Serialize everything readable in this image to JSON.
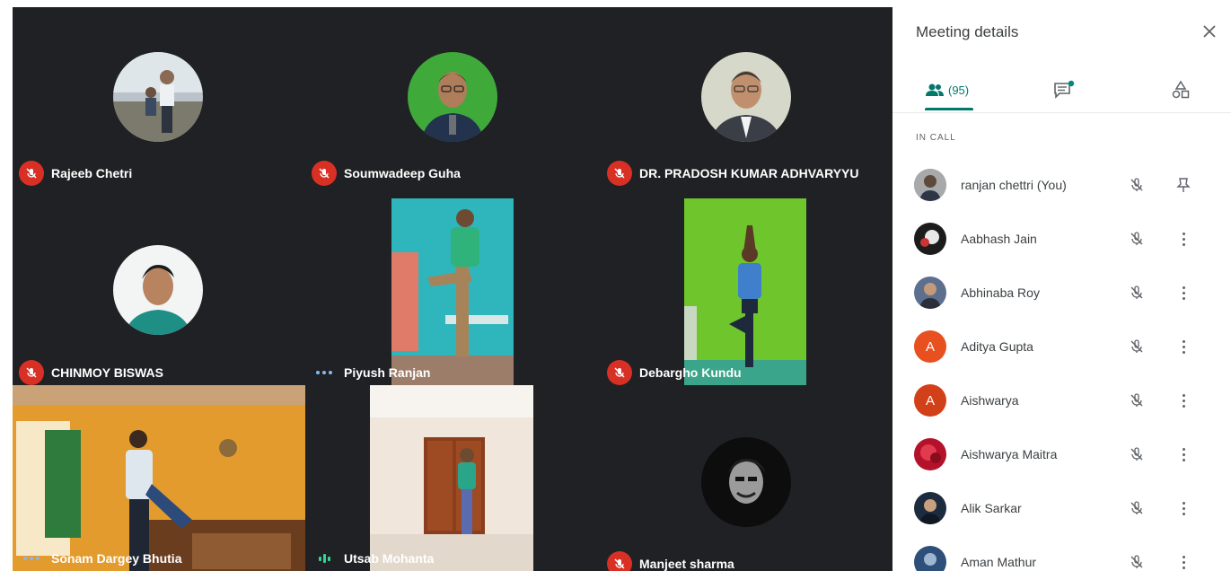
{
  "stage": {
    "tiles": [
      {
        "name": "Rajeeb Chetri",
        "indicator": "mic-off"
      },
      {
        "name": "Soumwadeep Guha",
        "indicator": "mic-off"
      },
      {
        "name": "DR. PRADOSH KUMAR ADHVARYYU",
        "indicator": "mic-off"
      },
      {
        "name": "CHINMOY BISWAS",
        "indicator": "mic-off"
      },
      {
        "name": "Piyush Ranjan",
        "indicator": "dots"
      },
      {
        "name": "Debargho Kundu",
        "indicator": "mic-off"
      },
      {
        "name": "Sonam Dargey Bhutia",
        "indicator": "dots"
      },
      {
        "name": "Utsab Mohanta",
        "indicator": "bars"
      },
      {
        "name": "Manjeet sharma",
        "indicator": "mic-off"
      }
    ]
  },
  "panel": {
    "title": "Meeting details",
    "people_tab_count": "(95)",
    "section_label": "IN CALL",
    "participants": [
      {
        "name": "ranjan chettri (You)",
        "initial": "",
        "action": "pin"
      },
      {
        "name": "Aabhash Jain",
        "initial": "",
        "action": "more"
      },
      {
        "name": "Abhinaba Roy",
        "initial": "",
        "action": "more"
      },
      {
        "name": "Aditya Gupta",
        "initial": "A",
        "action": "more"
      },
      {
        "name": "Aishwarya",
        "initial": "A",
        "action": "more"
      },
      {
        "name": "Aishwarya Maitra",
        "initial": "",
        "action": "more"
      },
      {
        "name": "Alik Sarkar",
        "initial": "",
        "action": "more"
      },
      {
        "name": "Aman Mathur",
        "initial": "",
        "action": "more"
      }
    ]
  },
  "colors": {
    "stage_bg": "#202124",
    "mic_off_red": "#d93025",
    "accent_teal": "#00796b",
    "avatar_orange": "#e8501f"
  }
}
